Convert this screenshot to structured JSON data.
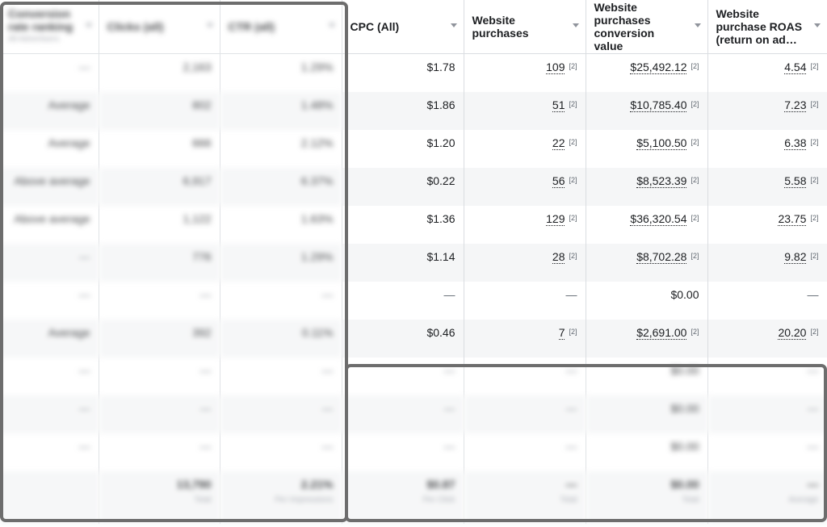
{
  "columns": [
    {
      "label": "Conversion rate ranking",
      "sub": "All Advertisers",
      "blurred": true
    },
    {
      "label": "Clicks (all)",
      "blurred": true
    },
    {
      "label": "CTR (all)",
      "blurred": true
    },
    {
      "label": "CPC (All)",
      "blurred": false
    },
    {
      "label": "Website purchases",
      "blurred": false
    },
    {
      "label": "Website purchases conversion value",
      "blurred": false
    },
    {
      "label": "Website purchase ROAS (return on ad…",
      "blurred": false
    }
  ],
  "rows": [
    [
      "—",
      "2,163",
      "1.29%",
      "$1.78",
      "109",
      "$25,492.12",
      "4.54"
    ],
    [
      "Average",
      "802",
      "1.48%",
      "$1.86",
      "51",
      "$10,785.40",
      "7.23"
    ],
    [
      "Average",
      "666",
      "2.12%",
      "$1.20",
      "22",
      "$5,100.50",
      "6.38"
    ],
    [
      "Above average",
      "6,917",
      "6.37%",
      "$0.22",
      "56",
      "$8,523.39",
      "5.58"
    ],
    [
      "Above average",
      "1,122",
      "1.63%",
      "$1.36",
      "129",
      "$36,320.54",
      "23.75"
    ],
    [
      "—",
      "776",
      "1.29%",
      "$1.14",
      "28",
      "$8,702.28",
      "9.82"
    ],
    [
      "—",
      "—",
      "—",
      "—",
      "—",
      "$0.00",
      "—"
    ],
    [
      "Average",
      "392",
      "0.11%",
      "$0.46",
      "7",
      "$2,691.00",
      "20.20"
    ],
    [
      "—",
      "—",
      "—",
      "—",
      "—",
      "$0.00",
      "—"
    ],
    [
      "—",
      "—",
      "—",
      "—",
      "—",
      "$0.00",
      "—"
    ],
    [
      "—",
      "—",
      "—",
      "—",
      "—",
      "$0.00",
      "—"
    ]
  ],
  "footnote_marker": "[2]",
  "totals": [
    {
      "value": "",
      "label": ""
    },
    {
      "value": "13,790",
      "label": "Total"
    },
    {
      "value": "2.21%",
      "label": "Per Impressions"
    },
    {
      "value": "$0.87",
      "label": "Per Click"
    },
    {
      "value": "—",
      "label": "Total"
    },
    {
      "value": "$0.00",
      "label": "Total"
    },
    {
      "value": "—",
      "label": "Average"
    }
  ]
}
